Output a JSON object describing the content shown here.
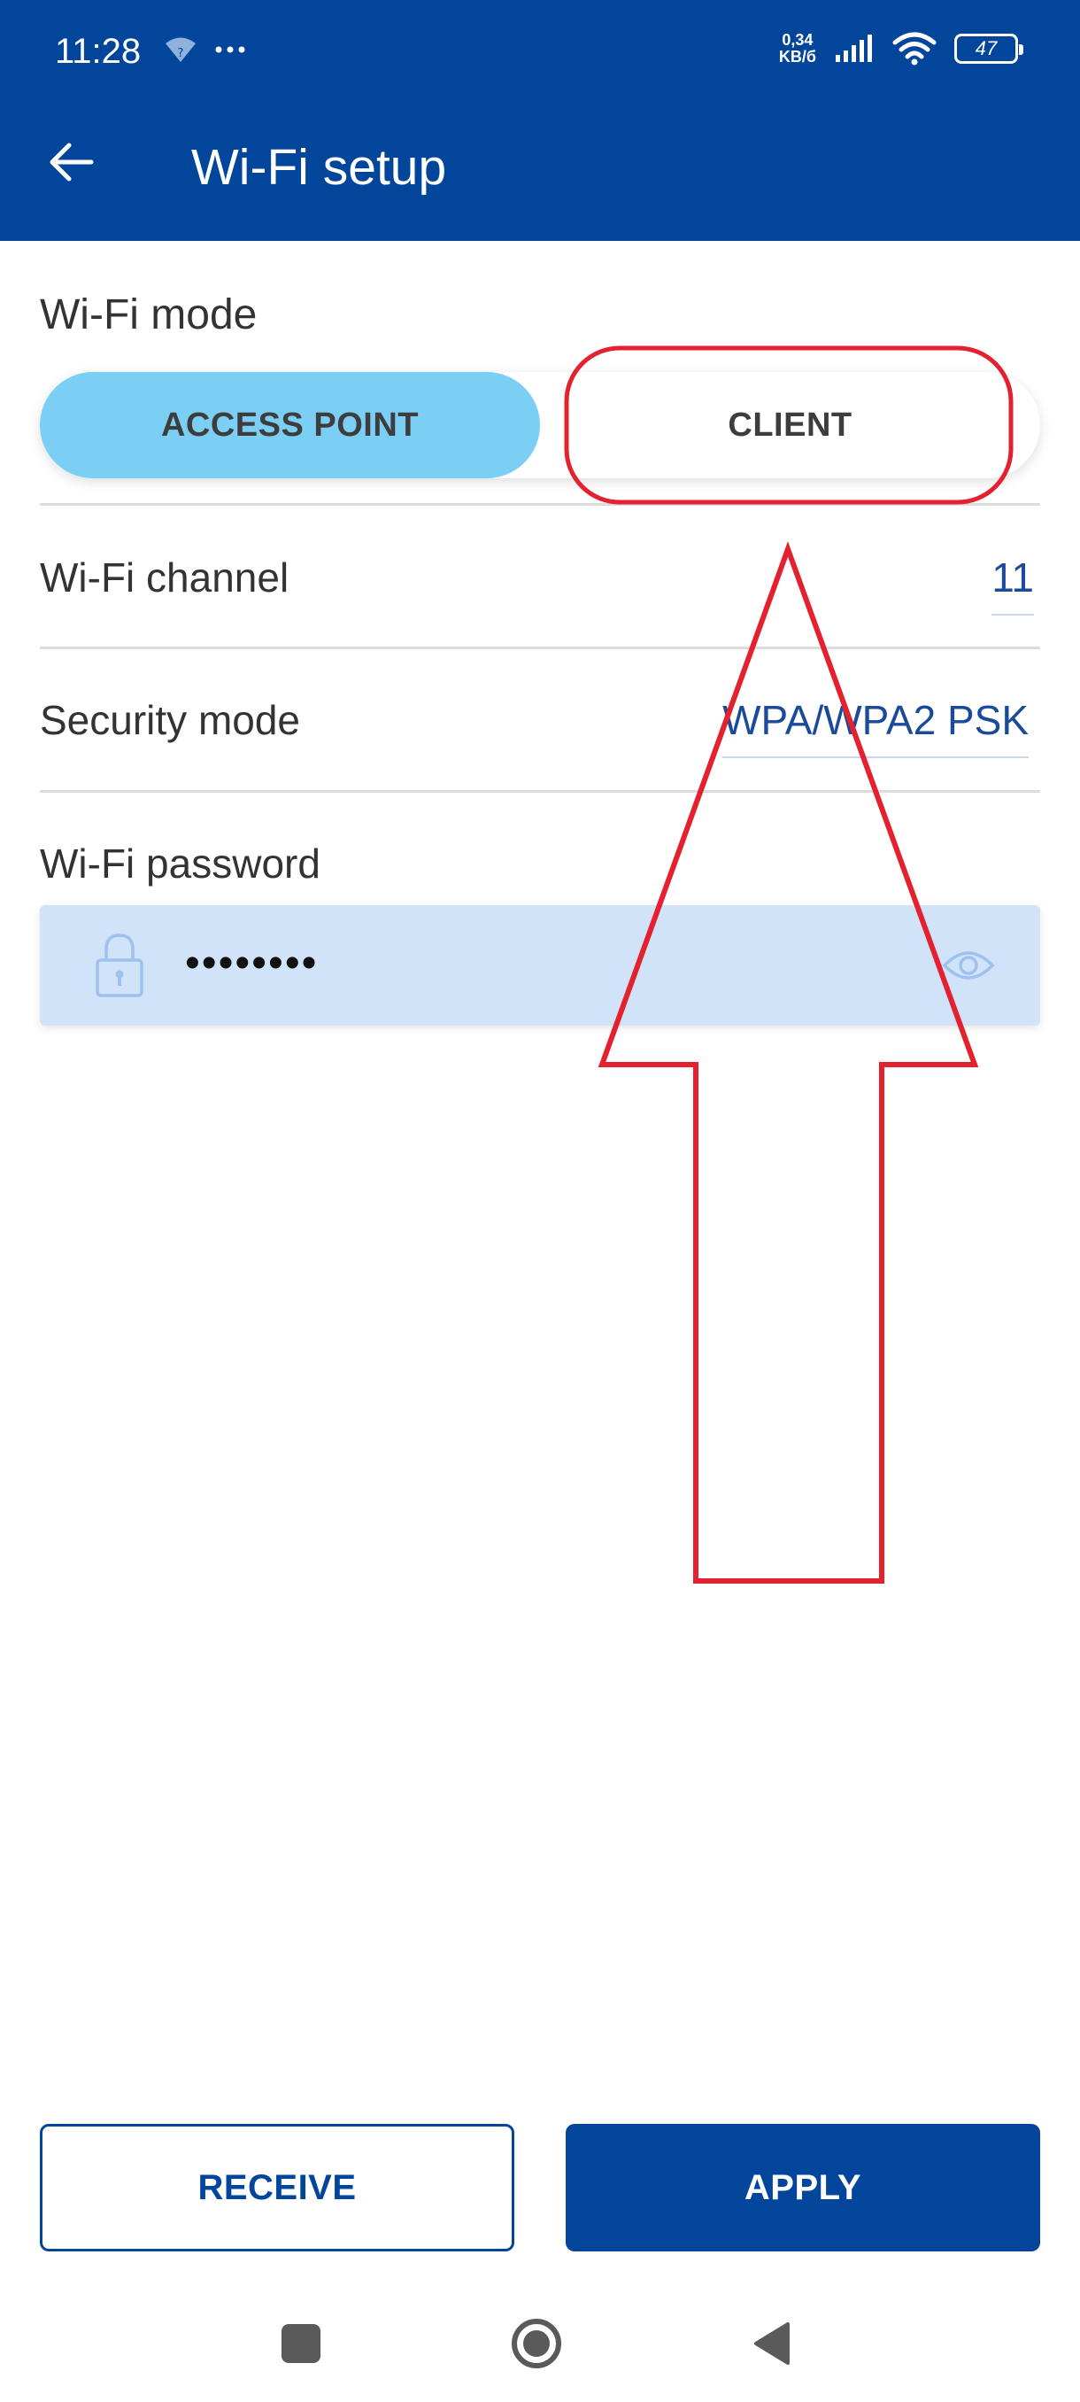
{
  "status_bar": {
    "time": "11:28",
    "net_speed_value": "0,34",
    "net_speed_unit": "KB/б",
    "battery": "47",
    "icons": [
      "wifi-unknown-icon",
      "more-dots-icon",
      "signal-icon",
      "wifi-icon",
      "battery-icon"
    ]
  },
  "header": {
    "title": "Wi-Fi setup",
    "back_icon": "arrow-left-icon"
  },
  "wifi_mode": {
    "label": "Wi-Fi mode",
    "options": [
      "ACCESS POINT",
      "CLIENT"
    ],
    "selected": "ACCESS POINT",
    "active_color": "#7ccff4"
  },
  "channel": {
    "label": "Wi-Fi channel",
    "value": "11"
  },
  "security": {
    "label": "Security mode",
    "value": "WPA/WPA2 PSK"
  },
  "password": {
    "label": "Wi-Fi password",
    "value": "••••••••",
    "lock_icon": "lock-icon",
    "toggle_icon": "eye-icon"
  },
  "actions": {
    "receive_label": "RECEIVE",
    "apply_label": "APPLY"
  },
  "colors": {
    "brand": "#02469c",
    "annotation_red": "#e3212f",
    "field_bg": "#d0e3f9"
  }
}
